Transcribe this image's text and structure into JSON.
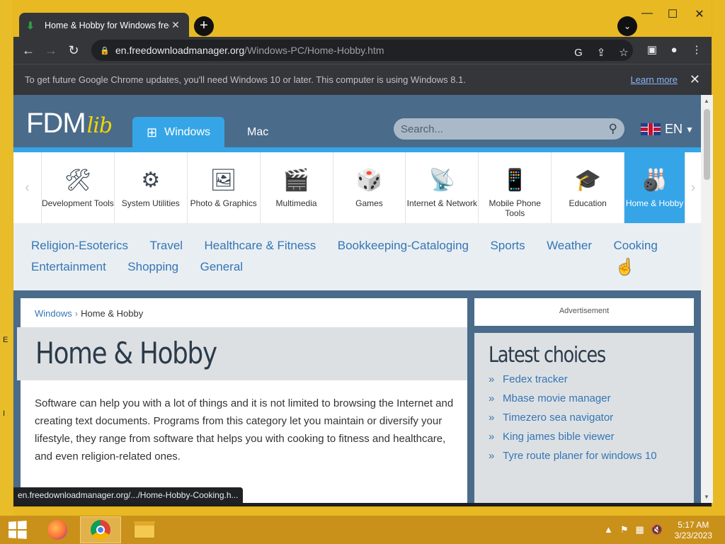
{
  "desktop": {
    "edge_letters": [
      "E",
      "I"
    ]
  },
  "browser": {
    "tab": {
      "title": "Home & Hobby for Windows free download",
      "favicon": "download-icon",
      "close": "✕"
    },
    "new_tab": "+",
    "tab_search": "⌄",
    "window_controls": {
      "minimize": "—",
      "maximize": "☐",
      "close": "✕"
    },
    "nav": {
      "back": "←",
      "forward": "→",
      "reload": "↻"
    },
    "url": {
      "domain": "en.freedownloadmanager.org",
      "path": "/Windows-PC/Home-Hobby.htm"
    },
    "omni_icons": [
      "google-lens-icon",
      "share-icon",
      "bookmark-star-icon"
    ],
    "toolbar_icons": [
      "side-panel-icon",
      "profile-icon",
      "menu-icon"
    ],
    "infobar": {
      "message": "To get future Google Chrome updates, you'll need Windows 10 or later. This computer is using Windows 8.1.",
      "link": "Learn more",
      "close": "✕"
    },
    "status_url": "en.freedownloadmanager.org/.../Home-Hobby-Cooking.h..."
  },
  "site": {
    "logo": {
      "main": "FDM",
      "sub": "lib"
    },
    "os_tabs": [
      {
        "label": "Windows",
        "icon": "windows-icon",
        "active": true
      },
      {
        "label": "Mac",
        "icon": "apple-icon",
        "active": false
      }
    ],
    "search": {
      "placeholder": "Search..."
    },
    "language": "EN",
    "categories": [
      {
        "label": "Development Tools",
        "icon": "tools-icon",
        "glyph": "🛠"
      },
      {
        "label": "System Utilities",
        "icon": "gears-icon",
        "glyph": "⚙"
      },
      {
        "label": "Photo & Graphics",
        "icon": "photo-icon",
        "glyph": "🖼"
      },
      {
        "label": "Multimedia",
        "icon": "clapperboard-icon",
        "glyph": "🎬"
      },
      {
        "label": "Games",
        "icon": "dice-icon",
        "glyph": "🎲"
      },
      {
        "label": "Internet & Network",
        "icon": "router-icon",
        "glyph": "📡"
      },
      {
        "label": "Mobile Phone Tools",
        "icon": "phone-globe-icon",
        "glyph": "📱"
      },
      {
        "label": "Education",
        "icon": "graduation-cap-icon",
        "glyph": "🎓"
      },
      {
        "label": "Home & Hobby",
        "icon": "bowling-icon",
        "glyph": "🎳",
        "active": true
      }
    ],
    "subcategories": [
      "Religion-Esoterics",
      "Travel",
      "Healthcare & Fitness",
      "Bookkeeping-Cataloging",
      "Sports",
      "Weather",
      "Cooking",
      "Entertainment",
      "Shopping",
      "General"
    ],
    "breadcrumb": {
      "root": "Windows",
      "sep": "›",
      "current": "Home & Hobby"
    },
    "page_title": "Home & Hobby",
    "description": "Software can help you with a lot of things and it is not limited to browsing the Internet and creating text documents. Programs from this category let you maintain or diversify your lifestyle, they range from software that helps you with cooking to fitness and healthcare, and even religion-related ones.",
    "ad_label": "Advertisement",
    "latest": {
      "title": "Latest choices",
      "items": [
        "Fedex tracker",
        "Mbase movie manager",
        "Timezero sea navigator",
        "King james bible viewer",
        "Tyre route planer for windows 10"
      ]
    }
  },
  "taskbar": {
    "apps": [
      "firefox-icon",
      "chrome-icon",
      "file-explorer-icon"
    ],
    "tray_icons": [
      "show-hidden-icon",
      "flag-icon",
      "network-icon",
      "volume-muted-icon"
    ],
    "time": "5:17 AM",
    "date": "3/23/2023"
  }
}
